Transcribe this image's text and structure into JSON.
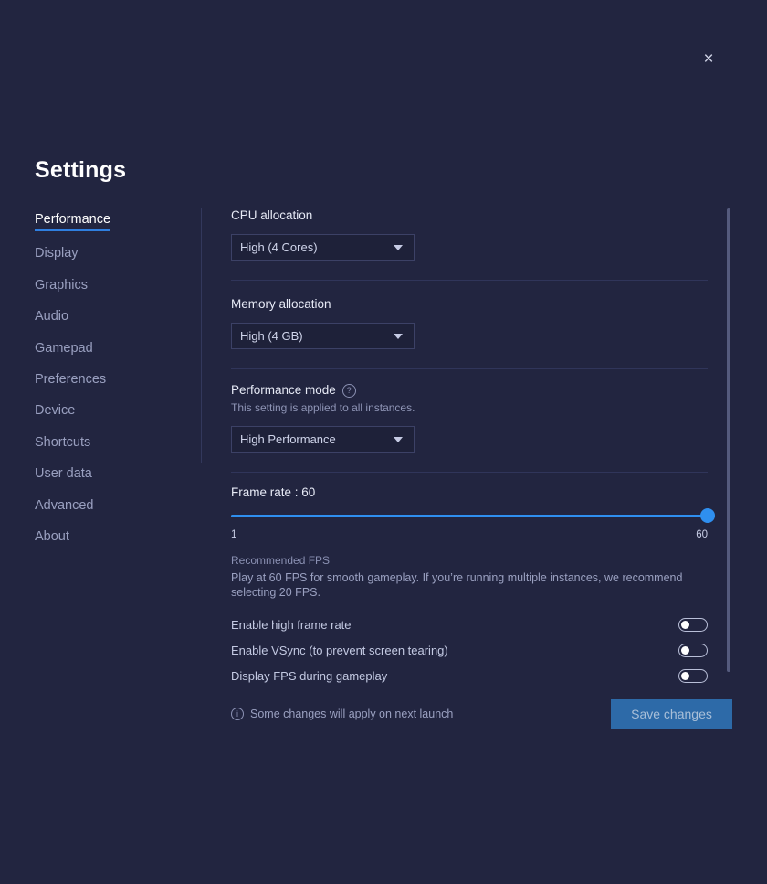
{
  "window": {
    "title": "Settings",
    "close_label": "×"
  },
  "sidebar": {
    "items": [
      {
        "label": "Performance",
        "active": true
      },
      {
        "label": "Display",
        "active": false
      },
      {
        "label": "Graphics",
        "active": false
      },
      {
        "label": "Audio",
        "active": false
      },
      {
        "label": "Gamepad",
        "active": false
      },
      {
        "label": "Preferences",
        "active": false
      },
      {
        "label": "Device",
        "active": false
      },
      {
        "label": "Shortcuts",
        "active": false
      },
      {
        "label": "User data",
        "active": false
      },
      {
        "label": "Advanced",
        "active": false
      },
      {
        "label": "About",
        "active": false
      }
    ]
  },
  "main": {
    "cpu": {
      "label": "CPU allocation",
      "value": "High (4 Cores)"
    },
    "memory": {
      "label": "Memory allocation",
      "value": "High (4 GB)"
    },
    "performance_mode": {
      "label": "Performance mode",
      "help_glyph": "?",
      "description": "This setting is applied to all instances.",
      "value": "High Performance"
    },
    "frame_rate": {
      "label": "Frame rate : 60",
      "value": 60,
      "min": 1,
      "max": 60,
      "min_label": "1",
      "max_label": "60",
      "fill_percent": 100,
      "recommend_title": "Recommended FPS",
      "recommend_body": "Play at 60 FPS for smooth gameplay. If you’re running multiple instances, we recommend selecting 20 FPS.",
      "accent_color": "#2f8fef"
    },
    "toggles": [
      {
        "label": "Enable high frame rate",
        "on": false
      },
      {
        "label": "Enable VSync (to prevent screen tearing)",
        "on": false
      },
      {
        "label": "Display FPS during gameplay",
        "on": false
      }
    ]
  },
  "footer": {
    "info_glyph": "i",
    "note": "Some changes will apply on next launch",
    "save_label": "Save changes"
  }
}
